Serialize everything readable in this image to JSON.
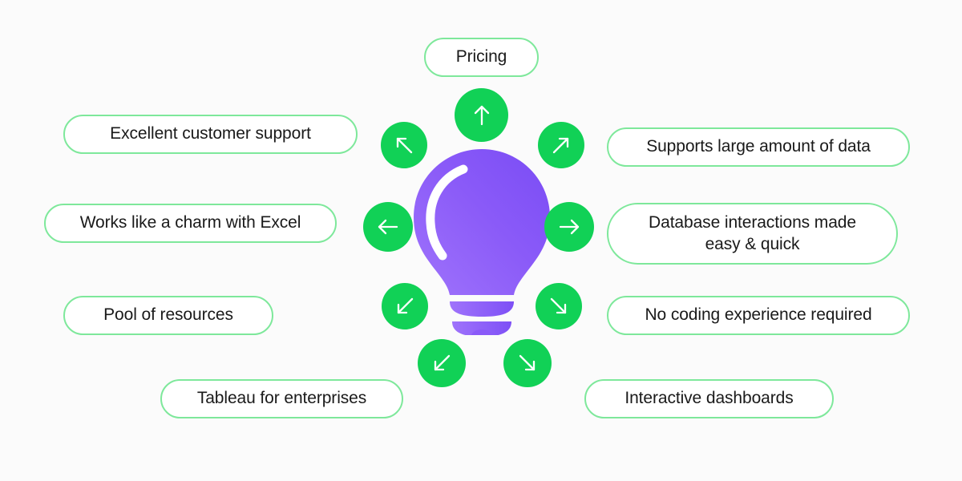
{
  "background_color": "#fbfbfb",
  "theme": {
    "pill_border": "#7ee89b",
    "pill_background": "#ffffff",
    "text_color": "#1a1a1a",
    "circle_green": "#11d156",
    "arrow_color": "#ffffff",
    "bulb_gradient_light": "#9b6bfa",
    "bulb_gradient_dark": "#7b4df5",
    "bulb_highlight": "#ffffff"
  },
  "center": {
    "icon": "lightbulb-icon"
  },
  "labels": [
    {
      "id": "pricing",
      "text": "Pricing",
      "position": "top"
    },
    {
      "id": "excellent-support",
      "text": "Excellent customer support",
      "position": "left-1"
    },
    {
      "id": "supports-large-data",
      "text": "Supports large amount of data",
      "position": "right-1"
    },
    {
      "id": "works-with-excel",
      "text": "Works like a charm with Excel",
      "position": "left-2"
    },
    {
      "id": "database-interactions",
      "text": "Database interactions made\neasy & quick",
      "position": "right-2"
    },
    {
      "id": "pool-of-resources",
      "text": "Pool of resources",
      "position": "left-3"
    },
    {
      "id": "no-coding-required",
      "text": "No coding experience required",
      "position": "right-3"
    },
    {
      "id": "tableau-enterprises",
      "text": "Tableau for enterprises",
      "position": "left-4"
    },
    {
      "id": "interactive-dashboards",
      "text": "Interactive dashboards",
      "position": "right-4"
    }
  ],
  "arrows": [
    {
      "id": "arrow-up",
      "icon": "arrow-up-icon",
      "direction": "up"
    },
    {
      "id": "arrow-up-left",
      "icon": "arrow-up-left-icon",
      "direction": "up-left"
    },
    {
      "id": "arrow-up-right",
      "icon": "arrow-up-right-icon",
      "direction": "up-right"
    },
    {
      "id": "arrow-left",
      "icon": "arrow-left-icon",
      "direction": "left"
    },
    {
      "id": "arrow-right",
      "icon": "arrow-right-icon",
      "direction": "right"
    },
    {
      "id": "arrow-down-left",
      "icon": "arrow-down-left-icon",
      "direction": "down-left"
    },
    {
      "id": "arrow-down-right",
      "icon": "arrow-down-right-icon",
      "direction": "down-right"
    },
    {
      "id": "arrow-down-left-2",
      "icon": "arrow-down-left-icon",
      "direction": "down-left"
    },
    {
      "id": "arrow-down-right-2",
      "icon": "arrow-down-right-icon",
      "direction": "down-right"
    }
  ]
}
